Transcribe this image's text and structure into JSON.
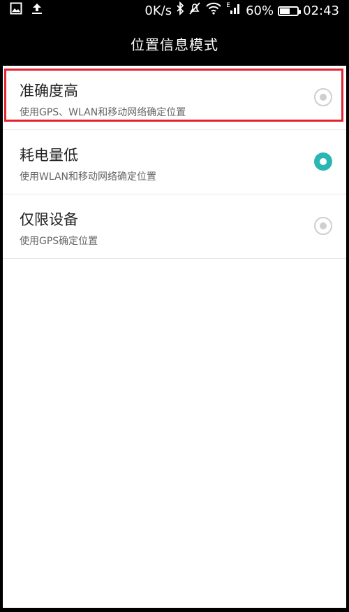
{
  "status_bar": {
    "left_icons": [
      "image-icon",
      "upload-icon"
    ],
    "network_speed": "0K/s",
    "right_icons": [
      "bluetooth-icon",
      "mute-icon",
      "wifi-icon",
      "signal-icon"
    ],
    "signal_type": "E",
    "battery_percent_text": "60%",
    "battery_level": 0.6,
    "time": "02:43"
  },
  "title_bar": {
    "title": "位置信息模式"
  },
  "options": [
    {
      "title": "准确度高",
      "subtitle": "使用GPS、WLAN和移动网络确定位置",
      "selected": false,
      "highlighted": true
    },
    {
      "title": "耗电量低",
      "subtitle": "使用WLAN和移动网络确定位置",
      "selected": true,
      "highlighted": false
    },
    {
      "title": "仅限设备",
      "subtitle": "使用GPS确定位置",
      "selected": false,
      "highlighted": false
    }
  ],
  "colors": {
    "accent": "#2ab7b4",
    "highlight": "#e0232e"
  }
}
